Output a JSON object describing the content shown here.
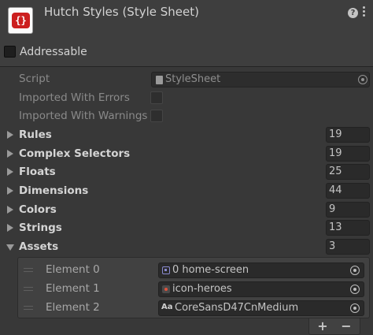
{
  "header": {
    "title": "Hutch Styles (Style Sheet)",
    "icon_text": "{}",
    "addressable_label": "Addressable"
  },
  "props": {
    "script_label": "Script",
    "script_value": "StyleSheet",
    "imported_errors_label": "Imported With Errors",
    "imported_warnings_label": "Imported With Warnings"
  },
  "collections": [
    {
      "label": "Rules",
      "count": "19"
    },
    {
      "label": "Complex Selectors",
      "count": "19"
    },
    {
      "label": "Floats",
      "count": "25"
    },
    {
      "label": "Dimensions",
      "count": "44"
    },
    {
      "label": "Colors",
      "count": "9"
    },
    {
      "label": "Strings",
      "count": "13"
    },
    {
      "label": "Assets",
      "count": "3"
    }
  ],
  "assets": [
    {
      "label": "Element 0",
      "value": "0 home-screen",
      "icon": "uxml-icon"
    },
    {
      "label": "Element 1",
      "value": "icon-heroes",
      "icon": "sprite-icon"
    },
    {
      "label": "Element 2",
      "value": "CoreSansD47CnMedium",
      "icon": "font-icon"
    }
  ],
  "footer": {
    "add_label": "+",
    "remove_label": "−"
  }
}
